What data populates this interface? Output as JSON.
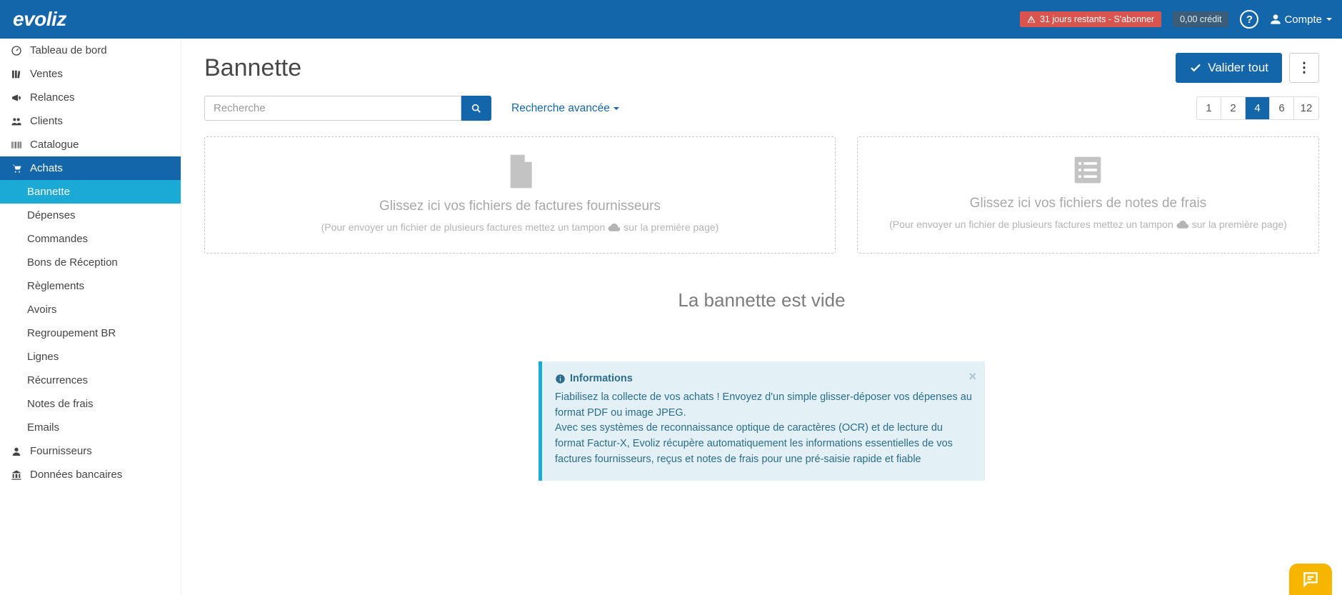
{
  "topbar": {
    "logo": "evoliz",
    "trial_text": "31 jours restants - S'abonner",
    "credit": "0,00 crédit",
    "account_label": "Compte"
  },
  "sidebar": {
    "items": [
      {
        "label": "Tableau de bord"
      },
      {
        "label": "Ventes"
      },
      {
        "label": "Relances"
      },
      {
        "label": "Clients"
      },
      {
        "label": "Catalogue"
      },
      {
        "label": "Achats"
      },
      {
        "label": "Fournisseurs"
      },
      {
        "label": "Données bancaires"
      }
    ],
    "achats_sub": [
      {
        "label": "Bannette"
      },
      {
        "label": "Dépenses"
      },
      {
        "label": "Commandes"
      },
      {
        "label": "Bons de Réception"
      },
      {
        "label": "Règlements"
      },
      {
        "label": "Avoirs"
      },
      {
        "label": "Regroupement BR"
      },
      {
        "label": "Lignes"
      },
      {
        "label": "Récurrences"
      },
      {
        "label": "Notes de frais"
      },
      {
        "label": "Emails"
      }
    ]
  },
  "page": {
    "title": "Bannette",
    "validate_all": "Valider tout",
    "search_placeholder": "Recherche",
    "advanced_search": "Recherche avancée",
    "pager": [
      "1",
      "2",
      "4",
      "6",
      "12"
    ],
    "pager_active": "4",
    "dropzone1_title": "Glissez ici vos fichiers de factures fournisseurs",
    "dropzone1_hint_a": "(Pour envoyer un fichier de plusieurs factures mettez un tampon",
    "dropzone1_hint_b": "sur la première page)",
    "dropzone2_title": "Glissez ici vos fichiers de notes de frais",
    "dropzone2_hint_a": "(Pour envoyer un fichier de plusieurs factures mettez un tampon",
    "dropzone2_hint_b": "sur la première page)",
    "empty": "La bannette est vide",
    "info_title": "Informations",
    "info_p1": "Fiabilisez la collecte de vos achats ! Envoyez d'un simple glisser-déposer vos dépenses au format PDF ou image JPEG.",
    "info_p2": "Avec ses systèmes de reconnaissance optique de caractères (OCR) et de lecture du format Factur-X, Evoliz récupère automatiquement les informations essentielles de vos factures fournisseurs, reçus et notes de frais pour une pré-saisie rapide et fiable"
  }
}
